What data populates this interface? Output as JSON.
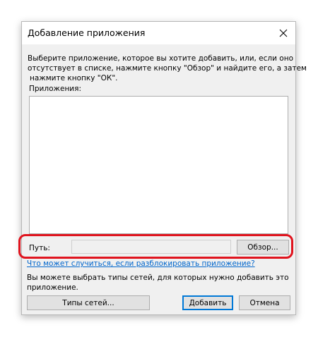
{
  "window": {
    "title": "Добавление приложения",
    "close_icon": "close-icon"
  },
  "description": {
    "line1": "Выберите приложение, которое вы хотите добавить, или, если оно",
    "line2": "отсутствует в списке, нажмите кнопку \"Обзор\" и найдите его, а затем",
    "line3": "нажмите кнопку \"ОК\"."
  },
  "apps": {
    "label": "Приложения:",
    "items": []
  },
  "path": {
    "label": "Путь:",
    "value": "",
    "browse_label": "Обзор..."
  },
  "risk_link": "Что может случиться, если разблокировать приложение?",
  "network": {
    "line1": "Вы можете выбрать типы сетей, для которых нужно добавить это",
    "line2": "приложение."
  },
  "buttons": {
    "network_types": "Типы сетей...",
    "add": "Добавить",
    "cancel": "Отмена"
  },
  "colors": {
    "highlight": "#e0141e",
    "link": "#0066cc",
    "default_button_border": "#0078d7"
  }
}
